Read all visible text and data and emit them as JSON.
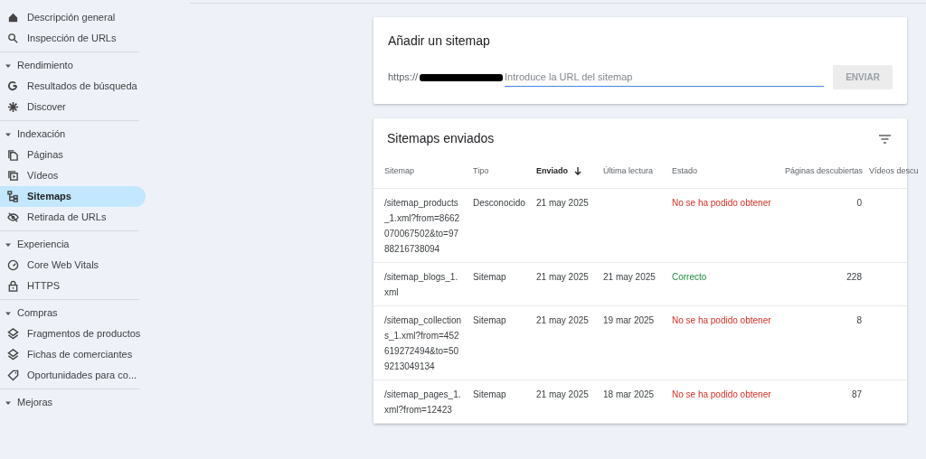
{
  "sidebar": {
    "items": [
      {
        "label": "Descripción general",
        "selected": false
      },
      {
        "label": "Inspección de URLs",
        "selected": false
      }
    ],
    "sections": [
      {
        "title": "Rendimiento",
        "expanded": true,
        "items": [
          {
            "label": "Resultados de búsqueda",
            "selected": false
          },
          {
            "label": "Discover",
            "selected": false
          }
        ]
      },
      {
        "title": "Indexación",
        "expanded": true,
        "items": [
          {
            "label": "Páginas",
            "selected": false
          },
          {
            "label": "Vídeos",
            "selected": false
          },
          {
            "label": "Sitemaps",
            "selected": true
          },
          {
            "label": "Retirada de URLs",
            "selected": false
          }
        ]
      },
      {
        "title": "Experiencia",
        "expanded": true,
        "items": [
          {
            "label": "Core Web Vitals",
            "selected": false
          },
          {
            "label": "HTTPS",
            "selected": false
          }
        ]
      },
      {
        "title": "Compras",
        "expanded": true,
        "items": [
          {
            "label": "Fragmentos de productos",
            "selected": false
          },
          {
            "label": "Fichas de comerciantes",
            "selected": false
          },
          {
            "label": "Oportunidades para co...",
            "selected": false
          }
        ]
      },
      {
        "title": "Mejoras",
        "expanded": true
      }
    ]
  },
  "add_sitemap": {
    "title": "Añadir un sitemap",
    "prefix": "https://",
    "placeholder": "Introduce la URL del sitemap",
    "button": {
      "label": "ENVIAR",
      "disabled": true
    }
  },
  "sitemaps": {
    "title": "Sitemaps enviados",
    "columns": [
      {
        "label": "Sitemap",
        "sorted": false
      },
      {
        "label": "Tipo",
        "sorted": false
      },
      {
        "label": "Enviado",
        "sorted": true
      },
      {
        "label": "Última lectura",
        "sorted": false
      },
      {
        "label": "Estado",
        "sorted": false
      },
      {
        "label": "Páginas descubiertas",
        "sorted": false
      },
      {
        "label": "Vídeos descu",
        "sorted": false
      }
    ],
    "rows": [
      {
        "sitemap": "/sitemap_products_1.xml?from=8662070067502&to=9788216738094",
        "type": "Desconocido",
        "submitted": "21 may 2025",
        "status": {
          "text": "No se ha podido obtener",
          "kind": "error"
        },
        "pages": "0"
      },
      {
        "sitemap": "/sitemap_blogs_1.xml",
        "type": "Sitemap",
        "submitted": "21 may 2025",
        "last_read": "21 may 2025",
        "status": {
          "text": "Correcto",
          "kind": "success"
        },
        "pages": "228"
      },
      {
        "sitemap": "/sitemap_collections_1.xml?from=452619272494&to=509213049134",
        "type": "Sitemap",
        "submitted": "21 may 2025",
        "last_read": "19 mar 2025",
        "status": {
          "text": "No se ha podido obtener",
          "kind": "error"
        },
        "pages": "8"
      },
      {
        "sitemap": "/sitemap_pages_1.xml?from=12423",
        "type": "Sitemap",
        "submitted": "21 may 2025",
        "last_read": "18 mar 2025",
        "status": {
          "text": "No se ha podido obtener",
          "kind": "error"
        },
        "pages": "87"
      }
    ]
  }
}
